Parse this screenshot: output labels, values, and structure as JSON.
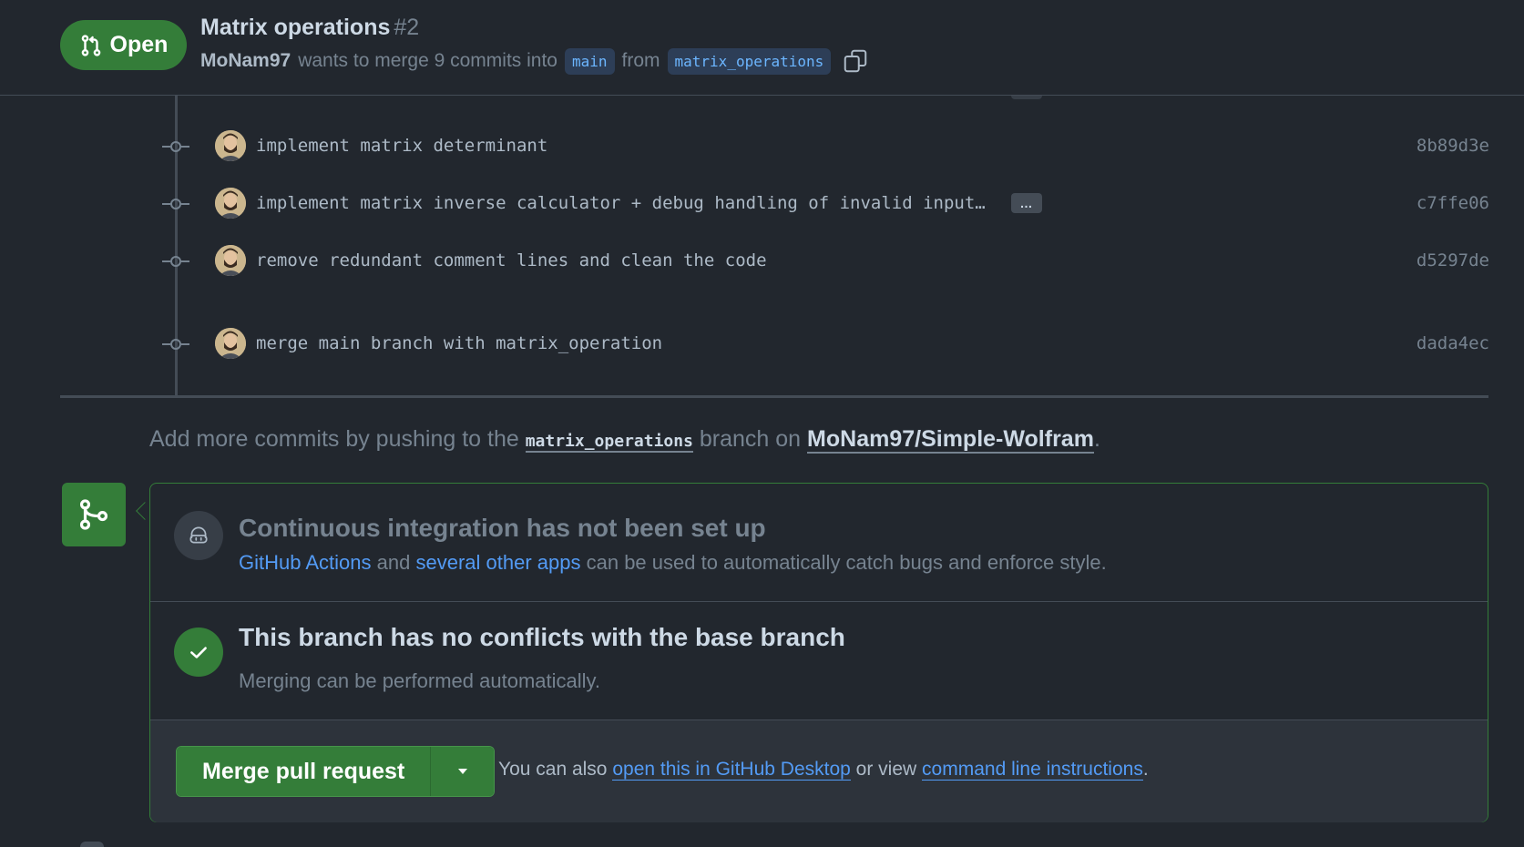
{
  "header": {
    "state_label": "Open",
    "title": "Matrix operations",
    "number": "#2",
    "author": "MoNam97",
    "meta_text": "wants to merge 9 commits into",
    "base_branch": "main",
    "from_text": "from",
    "head_branch": "matrix_operations"
  },
  "commits": [
    {
      "message": "implement matrix determinant",
      "sha": "8b89d3e",
      "has_ellipsis": false
    },
    {
      "message": "implement matrix inverse calculator + debug handling of invalid input…",
      "sha": "c7ffe06",
      "has_ellipsis": true,
      "ellipsis_label": "…"
    },
    {
      "message": "remove redundant comment lines and clean the code",
      "sha": "d5297de",
      "has_ellipsis": false
    },
    {
      "message": "merge main branch with matrix_operation",
      "sha": "dada4ec",
      "has_ellipsis": false
    }
  ],
  "push_hint": {
    "prefix": "Add more commits by pushing to the",
    "branch": "matrix_operations",
    "middle": "branch on",
    "repo": "MoNam97/Simple-Wolfram",
    "suffix": "."
  },
  "ci": {
    "title": "Continuous integration has not been set up",
    "link1": "GitHub Actions",
    "and_text": "and",
    "link2": "several other apps",
    "rest": "can be used to automatically catch bugs and enforce style."
  },
  "conflicts": {
    "title": "This branch has no conflicts with the base branch",
    "subtitle": "Merging can be performed automatically."
  },
  "actions": {
    "merge_button": "Merge pull request",
    "also_prefix": "You can also",
    "desktop_link": "open this in GitHub Desktop",
    "or_view": "or view",
    "cli_link": "command line instructions",
    "suffix": "."
  },
  "colors": {
    "background": "#22272e",
    "accent_green": "#347d39",
    "link_blue": "#539bf5",
    "branch_chip_bg": "#2d3e57"
  }
}
